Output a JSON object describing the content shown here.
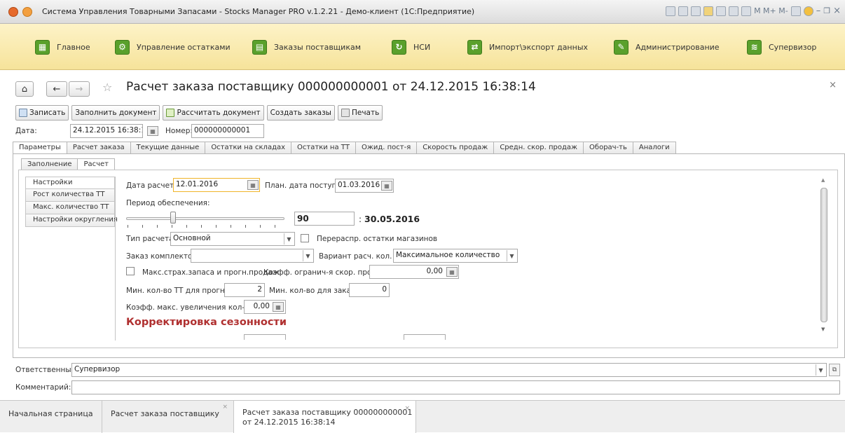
{
  "window": {
    "title": "Система Управления Товарными Запасами - Stocks Manager PRO v.1.2.21 - Демо-клиент (1С:Предприятие)",
    "tools_text": "M M+ M-"
  },
  "sections": [
    {
      "label": "Главное",
      "icon": "grid-icon"
    },
    {
      "label": "Управление остатками",
      "icon": "gears-icon"
    },
    {
      "label": "Заказы поставщикам",
      "icon": "basket-icon"
    },
    {
      "label": "НСИ",
      "icon": "refresh-icon"
    },
    {
      "label": "Импорт\\экспорт данных",
      "icon": "arrows-icon"
    },
    {
      "label": "Администрирование",
      "icon": "tools-icon"
    },
    {
      "label": "Супервизор",
      "icon": "chart-icon"
    }
  ],
  "document": {
    "title": "Расчет заказа поставщику 000000000001 от 24.12.2015 16:38:14"
  },
  "toolbar": {
    "save": "Записать",
    "fill": "Заполнить документ",
    "calc": "Рассчитать документ",
    "create": "Создать заказы",
    "print": "Печать"
  },
  "header": {
    "date_label": "Дата:",
    "date_value": "24.12.2015 16:38:14",
    "number_label": "Номер:",
    "number_value": "000000000001"
  },
  "tabs": [
    "Параметры",
    "Расчет заказа",
    "Текущие данные",
    "Остатки на складах",
    "Остатки на ТТ",
    "Ожид. пост-я",
    "Скорость продаж",
    "Средн. скор. продаж",
    "Оборач-ть",
    "Аналоги"
  ],
  "subtabs": [
    "Заполнение",
    "Расчет"
  ],
  "leftnav": [
    "Настройки",
    "Рост количества ТТ",
    "Макс. количество ТТ",
    "Настройки округления"
  ],
  "form": {
    "calc_date_label": "Дата расчета:",
    "calc_date_value": "12.01.2016",
    "plan_date_label": "План. дата поступл-я:",
    "plan_date_value": "01.03.2016",
    "period_label": "Период обеспечения:",
    "period_value": "90",
    "period_colon": ":",
    "period_end": "30.05.2016",
    "calc_type_label": "Тип расчета:",
    "calc_type_value": "Основной",
    "redistribute_label": "Перераспр. остатки магазинов",
    "kits_label": "Заказ комплектов:",
    "kits_value": "",
    "variant_label": "Вариант расч. кол. ТТ:",
    "variant_value": "Максимальное количество",
    "max_reserve_label": "Макс.страх.запаса и прогн.продаж",
    "coef_limit_label": "Коэфф. огранич-я скор. продаж:",
    "coef_limit_value": "0,00",
    "min_tt_label": "Мин. кол-во ТТ для прогноза:",
    "min_tt_value": "2",
    "min_order_label": "Мин. кол-во для заказа:",
    "min_order_value": "0",
    "coef_max_label": "Коэфф. макс. увеличения кол-ва ТТ:",
    "coef_max_value": "0,00",
    "season_title": "Корректировка сезонности"
  },
  "footer": {
    "responsible_label": "Ответственный:",
    "responsible_value": "Супервизор",
    "comment_label": "Комментарий:",
    "comment_value": ""
  },
  "bottom_tabs": [
    {
      "label": "Начальная страница"
    },
    {
      "label": "Расчет заказа поставщику"
    },
    {
      "label_line1": "Расчет заказа поставщику 000000000001",
      "label_line2": "от 24.12.2015 16:38:14"
    }
  ],
  "colors": {
    "section_bar": "#f6e39a",
    "accent_green": "#5aa02c",
    "season_red": "#b03030",
    "focus_border": "#f0b429"
  }
}
